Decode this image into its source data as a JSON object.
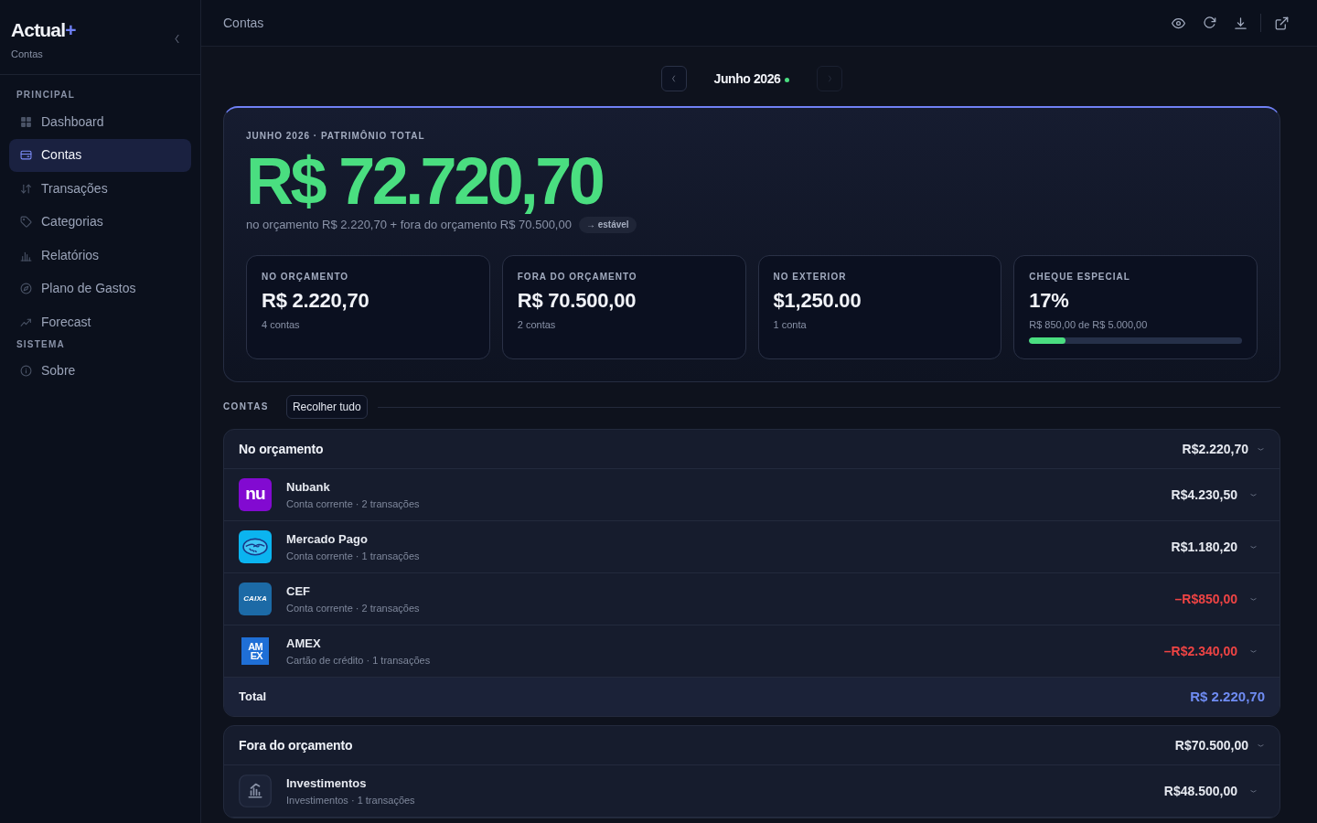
{
  "sidebar": {
    "logo": "Actual",
    "logo_mark": "+",
    "subtitle": "Contas",
    "sections": [
      {
        "title": "PRINCIPAL",
        "items": [
          {
            "label": "Dashboard",
            "selected": false
          },
          {
            "label": "Contas",
            "selected": true
          },
          {
            "label": "Transações",
            "selected": false
          },
          {
            "label": "Categorias",
            "selected": false
          },
          {
            "label": "Relatórios",
            "selected": false
          },
          {
            "label": "Plano de Gastos",
            "selected": false
          },
          {
            "label": "Forecast",
            "selected": false
          }
        ]
      },
      {
        "title": "SISTEMA",
        "items": [
          {
            "label": "Sobre",
            "selected": false
          }
        ]
      }
    ]
  },
  "topbar": {
    "title": "Contas"
  },
  "month_nav": {
    "label": "Junho 2026",
    "current": true,
    "prev_disabled": false,
    "next_disabled": true
  },
  "hero": {
    "caption": "JUNHO 2026 · PATRIMÔNIO TOTAL",
    "total": "R$ 72.720,70",
    "breakdown": "no orçamento R$ 2.220,70 + fora do orçamento R$ 70.500,00",
    "trend": "→ estável"
  },
  "stats": [
    {
      "kind": "value",
      "label": "NO ORÇAMENTO",
      "value": "R$ 2.220,70",
      "sub": "4 contas"
    },
    {
      "kind": "value",
      "label": "FORA DO ORÇAMENTO",
      "value": "R$ 70.500,00",
      "sub": "2 contas"
    },
    {
      "kind": "value",
      "label": "NO EXTERIOR",
      "value": "$1,250.00",
      "sub": "1 conta"
    },
    {
      "kind": "meter",
      "label": "CHEQUE ESPECIAL",
      "value": "17%",
      "sub": "R$ 850,00 de R$ 5.000,00",
      "level": 0.17
    }
  ],
  "accounts_section": {
    "title": "CONTAS",
    "collapse_button": "Recolher tudo"
  },
  "groups": [
    {
      "name": "No orçamento",
      "total": "R$2.220,70",
      "expanded": true,
      "accounts": [
        {
          "kind": "nubank",
          "logo_text": [
            "nu"
          ],
          "name": "Nubank",
          "detail": "Conta corrente · 2 transações",
          "balance": "R$4.230,50",
          "negative": false
        },
        {
          "kind": "mercadopago",
          "name": "Mercado Pago",
          "detail": "Conta corrente · 1 transações",
          "balance": "R$1.180,20",
          "negative": false
        },
        {
          "kind": "caixa",
          "logo_text": [
            "CAIXA"
          ],
          "name": "CEF",
          "detail": "Conta corrente · 2 transações",
          "balance": "–R$850,00",
          "negative": true
        },
        {
          "kind": "amex",
          "logo_text": [
            "AM",
            "EX"
          ],
          "name": "AMEX",
          "detail": "Cartão de crédito · 1 transações",
          "balance": "–R$2.340,00",
          "negative": true
        }
      ],
      "footer": {
        "label": "Total",
        "value": "R$ 2.220,70"
      }
    },
    {
      "name": "Fora do orçamento",
      "total": "R$70.500,00",
      "expanded": true,
      "accounts": [
        {
          "kind": "investment",
          "name": "Investimentos",
          "detail": "Investimentos · 1 transações",
          "balance": "R$48.500,00",
          "negative": false
        }
      ]
    }
  ]
}
